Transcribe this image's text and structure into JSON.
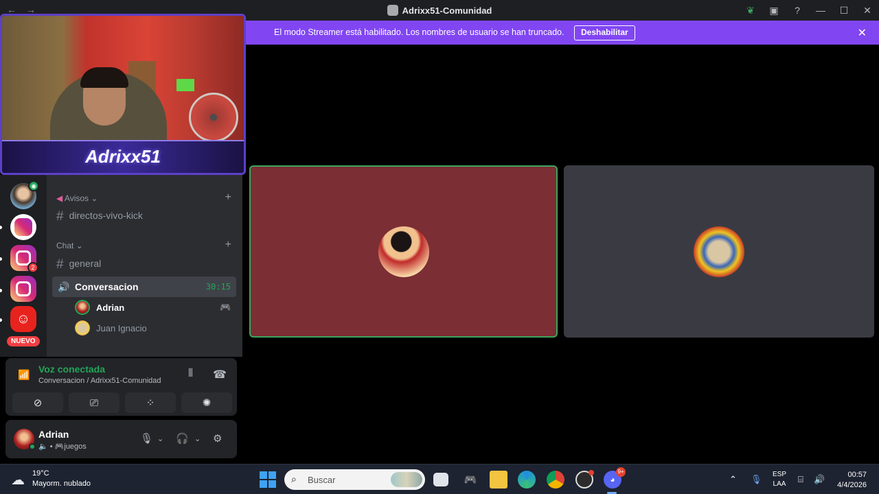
{
  "window": {
    "title": "Adrixx51-Comunidad",
    "back_icon": "←",
    "forward_icon": "→",
    "minimize": "—",
    "maximize": "☐",
    "close": "✕"
  },
  "banner": {
    "text": "El modo Streamer está habilitado. Los nombres de usuario se han truncado.",
    "button": "Deshabilitar",
    "close": "✕",
    "color": "#8146f2"
  },
  "webcam": {
    "overlay_name": "Adrixx51"
  },
  "server_rail": {
    "badges": [
      "2"
    ],
    "new_label": "NUEVO"
  },
  "channels": {
    "categories": [
      {
        "label": "Avisos",
        "chevron": "⌄",
        "plus": "+"
      },
      {
        "label": "Chat",
        "chevron": "⌄",
        "plus": "+"
      }
    ],
    "text_channels": [
      {
        "name": "directos-vivo-kick"
      },
      {
        "name": "general"
      }
    ],
    "voice_channel": {
      "name": "Conversacion",
      "timer": "30:15"
    },
    "voice_users": [
      {
        "name": "Adrian",
        "activity_icon": "gamepad-icon"
      },
      {
        "name": "Juan Ignacio"
      }
    ]
  },
  "voice_panel": {
    "title": "Voz conectada",
    "subtitle": "Conversacion / Adrixx51-Comunidad",
    "status_color": "#23a559"
  },
  "user": {
    "name": "Adrian",
    "status": "juegos"
  },
  "taskbar": {
    "temperature": "19°C",
    "condition": "Mayorm. nublado",
    "search_placeholder": "Buscar",
    "discord_badge": "9+",
    "lang_top": "ESP",
    "lang_bottom": "LAA",
    "time": "00:57",
    "date": "4/4/2026"
  }
}
